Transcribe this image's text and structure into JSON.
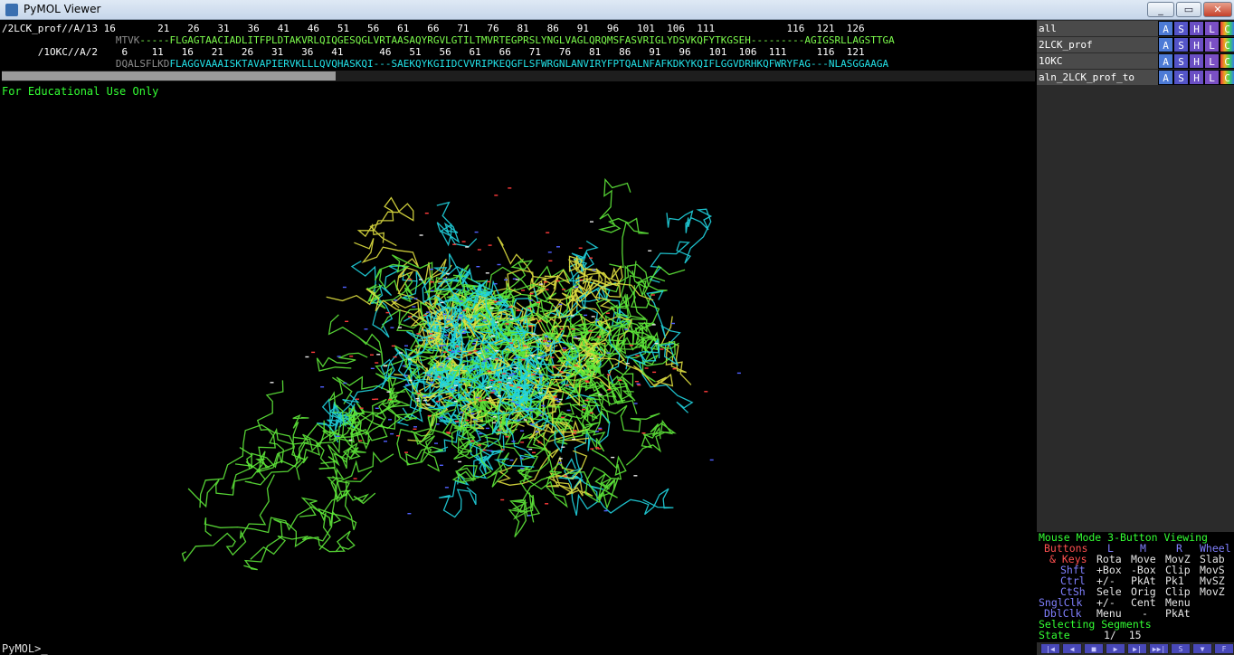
{
  "window": {
    "title": "PyMOL Viewer",
    "buttons": [
      "_",
      "▭",
      "✕"
    ]
  },
  "sequence_viewer": {
    "row1_label_and_numbers": "/2LCK_prof//A/13 16       21   26   31   36   41   46   51   56   61   66   71   76   81   86   91   96   101  106  111            116  121  126",
    "row2_prefix_gray": "                   MTVK",
    "row2_seq": "-----FLGAGTAACIADLITFPLDTAKVRLQIQGESQGLVRTAASAQYRGVLGTILTMVRTEGPRSLYNGLVAGLQRQMSFASVRIGLYDSVKQFYTKGSEH---------AGIGSRLLAGSTTGA",
    "row3_label_and_numbers": "      /1OKC//A/2    6    11   16   21   26   31   36   41      46   51   56   61   66   71   76   81   86   91   96   101  106  111     116  121",
    "row4_prefix_gray": "                   DQALSFLKD",
    "row4_seq": "FLAGGVAAAISKTAVAPIERVKLLLQVQHASKQI---SAEKQYKGIIDCVVRIPKEQGFLSFWRGNLANVIRYFPTQALNFAFKDKYKQIFLGGVDRHKQFWRYFAG---NLASGGAAGA"
  },
  "viewport": {
    "watermark": "For Educational Use Only"
  },
  "command_line": {
    "prompt": "PyMOL>_"
  },
  "objects": [
    {
      "name": "all",
      "buttons": [
        "A",
        "S",
        "H",
        "L",
        "C"
      ]
    },
    {
      "name": "2LCK_prof",
      "buttons": [
        "A",
        "S",
        "H",
        "L",
        "C"
      ]
    },
    {
      "name": "1OKC",
      "buttons": [
        "A",
        "S",
        "H",
        "L",
        "C"
      ]
    },
    {
      "name": "aln_2LCK_prof_to",
      "buttons": [
        "A",
        "S",
        "H",
        "L",
        "C"
      ]
    }
  ],
  "mouse_panel": {
    "mode": "Mouse Mode 3-Button Viewing",
    "buttons_row": [
      "Buttons",
      "L",
      "M",
      "R",
      "Wheel"
    ],
    "keys_row": [
      "& Keys",
      "Rota",
      "Move",
      "MovZ",
      "Slab"
    ],
    "shft_row": [
      "Shft",
      "+Box",
      "-Box",
      "Clip",
      "MovS"
    ],
    "ctrl_row": [
      "Ctrl",
      "+/-",
      "PkAt",
      "Pk1",
      "MvSZ"
    ],
    "ctsh_row": [
      "CtSh",
      "Sele",
      "Orig",
      "Clip",
      "MovZ"
    ],
    "snglclk_row": [
      "SnglClk",
      "+/-",
      "Cent",
      "Menu"
    ],
    "dblclk_row": [
      "DblClk",
      "Menu",
      "-",
      "PkAt"
    ],
    "selecting": "Selecting Segments",
    "state_label": "State",
    "state_value": "1/  15"
  },
  "playback_buttons": [
    "|◀",
    "◀",
    "■",
    "▶",
    "▶|",
    "▶▶|",
    "S",
    "▼",
    "F"
  ],
  "colors": {
    "object_name_bg": "#4a4a4a",
    "btn_A": "#4d7bd6",
    "btn_S": "#5454c8",
    "btn_H": "#6a4fc4",
    "btn_L": "#7a4fc4",
    "btn_C": "#e8b020",
    "structure_green": "#5ee83a",
    "structure_cyan": "#20d4e0",
    "structure_yellow": "#e0e040"
  }
}
